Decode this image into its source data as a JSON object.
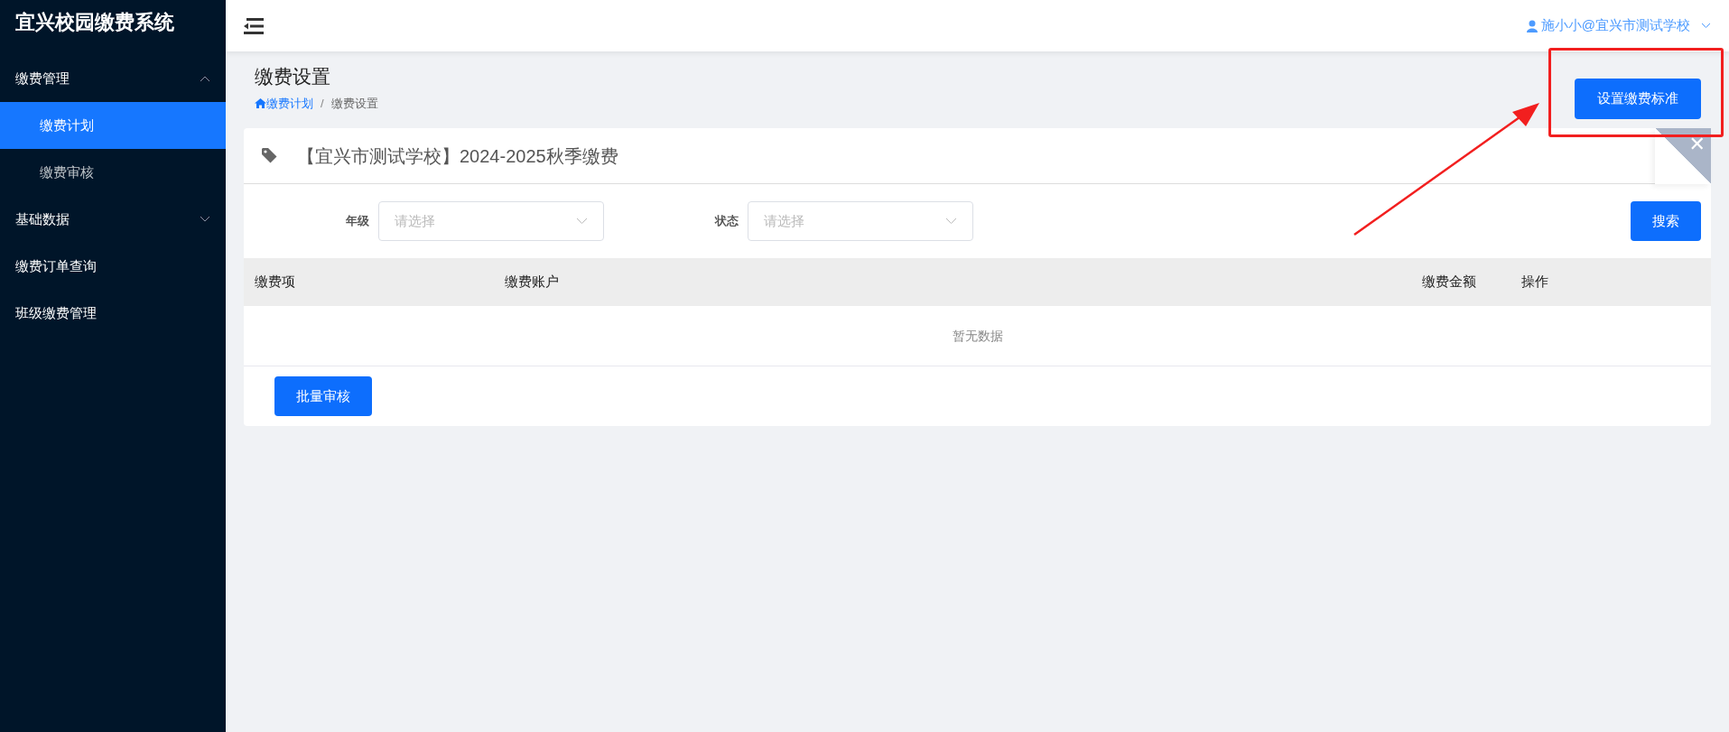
{
  "sidebar": {
    "brand": "宜兴校园缴费系统",
    "items": [
      {
        "label": "缴费管理",
        "expanded": true,
        "selected": false,
        "children": [
          {
            "label": "缴费计划",
            "selected": true
          },
          {
            "label": "缴费审核",
            "selected": false
          }
        ]
      },
      {
        "label": "基础数据",
        "expanded": false,
        "selected": false
      },
      {
        "label": "缴费订单查询",
        "selected": false
      },
      {
        "label": "班级缴费管理",
        "selected": false
      }
    ]
  },
  "header": {
    "user": "施小小@宜兴市测试学校"
  },
  "page": {
    "title": "缴费设置",
    "breadcrumb": [
      {
        "label": "缴费计划",
        "kind": "link"
      },
      {
        "label": "缴费设置",
        "kind": "current"
      }
    ],
    "breadcrumb_separator": "/",
    "action_button": "设置缴费标准"
  },
  "card": {
    "title": "【宜兴市测试学校】2024-2025秋季缴费",
    "close_mark": "✕",
    "filters": [
      {
        "label": "年级",
        "placeholder": "请选择"
      },
      {
        "label": "状态",
        "placeholder": "请选择"
      }
    ],
    "search_button": "搜索",
    "table": {
      "columns": [
        "缴费项",
        "缴费账户",
        "缴费金额",
        "操作"
      ],
      "empty_text": "暂无数据"
    },
    "footer_button": "批量审核"
  }
}
